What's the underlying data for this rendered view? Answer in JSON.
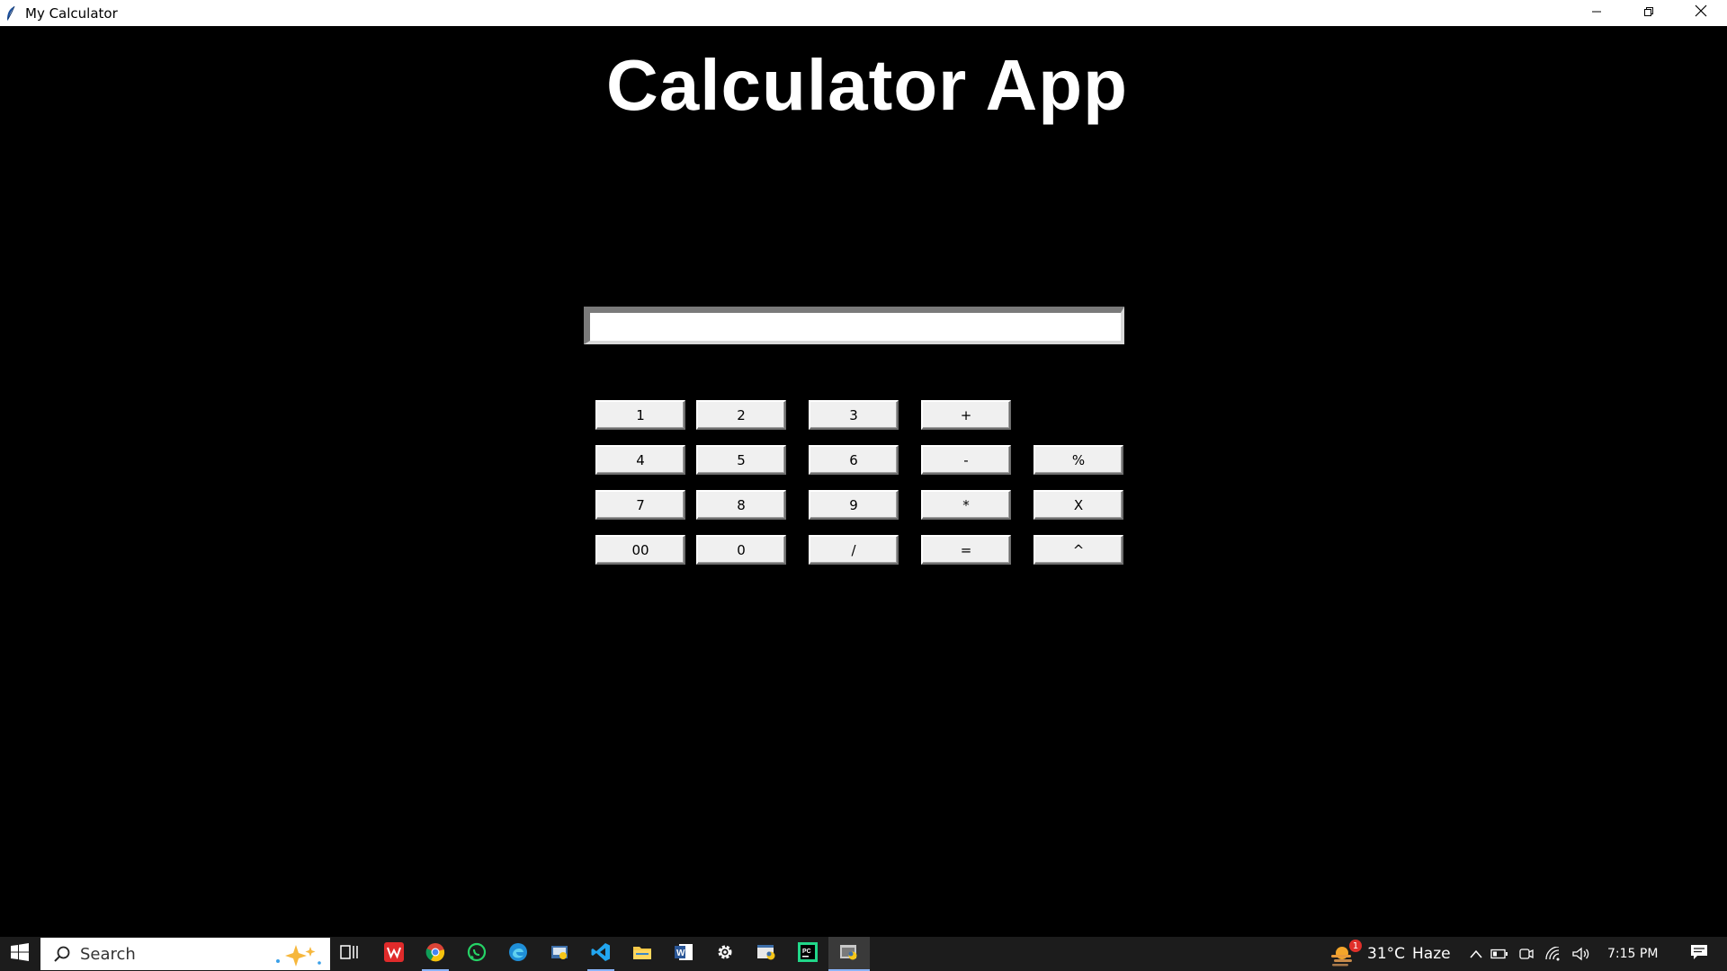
{
  "window": {
    "title": "My Calculator",
    "controls": {
      "minimize": "minimize-icon",
      "restore": "restore-icon",
      "close": "close-icon"
    }
  },
  "app": {
    "heading": "Calculator App",
    "display": {
      "value": "",
      "placeholder": ""
    }
  },
  "keypad": {
    "rows": [
      [
        "1",
        "2",
        "3",
        "+"
      ],
      [
        "4",
        "5",
        "6",
        "-",
        "%"
      ],
      [
        "7",
        "8",
        "9",
        "*",
        "X"
      ],
      [
        "00",
        "0",
        "/",
        "=",
        "^"
      ]
    ]
  },
  "taskbar": {
    "search_placeholder": "Search",
    "pinned": [
      "wps-office-icon",
      "chrome-icon",
      "whatsapp-icon",
      "edge-icon",
      "python-idle-icon",
      "vscode-icon",
      "file-explorer-icon",
      "word-icon",
      "settings-icon",
      "python-launcher-icon",
      "pycharm-icon",
      "python-app-icon"
    ],
    "weather": {
      "temperature": "31°C",
      "condition": "Haze",
      "badge": "1"
    },
    "clock": "7:15 PM"
  },
  "colors": {
    "background": "#000000",
    "heading": "#ffffff",
    "button_face": "#f0f0f0",
    "taskbar": "#1c1c1c"
  }
}
